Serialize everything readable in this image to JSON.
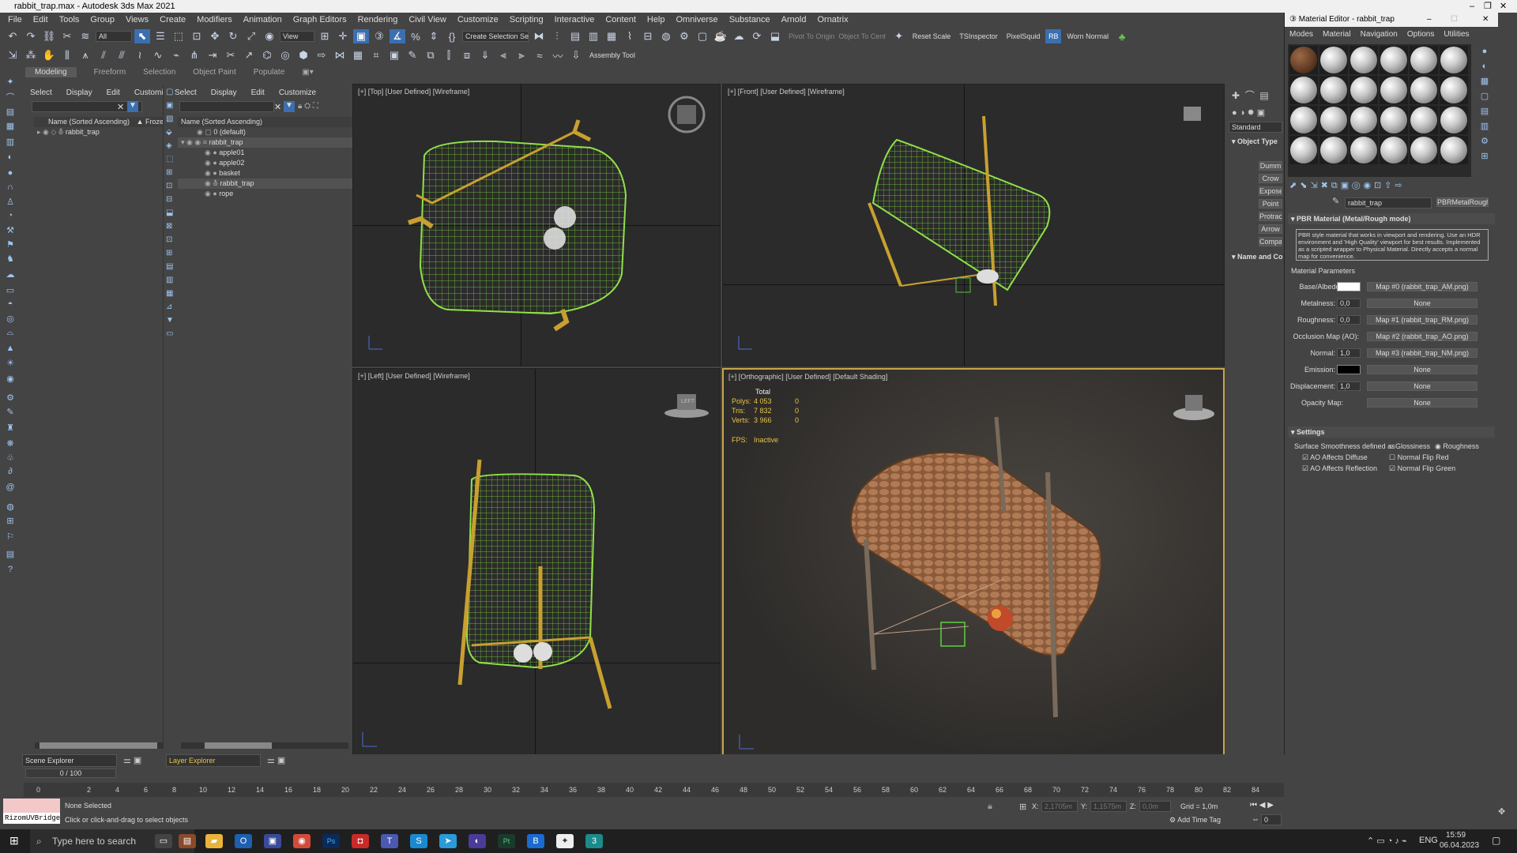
{
  "window": {
    "title": "rabbit_trap.max - Autodesk 3ds Max 2021",
    "controls": [
      "–",
      "❐",
      "✕"
    ]
  },
  "menu": [
    "File",
    "Edit",
    "Tools",
    "Group",
    "Views",
    "Create",
    "Modifiers",
    "Animation",
    "Graph Editors",
    "Rendering",
    "Civil View",
    "Customize",
    "Scripting",
    "Interactive",
    "Content",
    "Help",
    "Omniverse",
    "Substance",
    "Arnold",
    "Ornatrix"
  ],
  "toolbar": {
    "selection_filter": "All",
    "ref_coord": "View",
    "selection_set": "Create Selection Se",
    "pivot_to_origin": "Pivot To Origin",
    "object_to_center": "Object To Cent",
    "reset_scale": "Reset Scale",
    "tsinspector": "TSInspector",
    "pixelsquid": "PixelSquid",
    "worn_normal": "Worn Normal",
    "assembly_tool": "Assembly Tool"
  },
  "ribbon_tabs": [
    "Modeling",
    "Freeform",
    "Selection",
    "Object Paint",
    "Populate"
  ],
  "scene_explorer": {
    "menu": [
      "Select",
      "Display",
      "Edit",
      "Customize"
    ],
    "column": "Name (Sorted Ascending)",
    "frozen_col": "▲ Frozen",
    "items": [
      "rabbit_trap"
    ],
    "footer_label": "Scene Explorer"
  },
  "layer_explorer": {
    "menu": [
      "Select",
      "Display",
      "Edit",
      "Customize"
    ],
    "column": "Name (Sorted Ascending)",
    "items": [
      "0 (default)",
      "rabbit_trap",
      "apple01",
      "apple02",
      "basket",
      "rabbit_trap",
      "rope"
    ],
    "footer_label": "Layer Explorer"
  },
  "viewports": {
    "top": "[+] [Top] [User Defined] [Wireframe]",
    "front": "[+] [Front] [User Defined] [Wireframe]",
    "left": "[+] [Left] [User Defined] [Wireframe]",
    "persp": "[+] [Orthographic] [User Defined] [Default Shading]",
    "stats": {
      "header": "Total",
      "polys_label": "Polys:",
      "polys": "4 053",
      "polys_sel": "0",
      "tris_label": "Tris:",
      "tris": "7 832",
      "tris_sel": "0",
      "verts_label": "Verts:",
      "verts": "3 966",
      "verts_sel": "0",
      "fps_label": "FPS:",
      "fps": "Inactive"
    },
    "cube_left": "LEFT"
  },
  "command_panel": {
    "dropdown": "Standard",
    "object_type": "Object Type",
    "buttons": [
      "Dumm",
      "Crow",
      "Expose",
      "Point",
      "Protrac",
      "Arrow",
      "Compa"
    ],
    "name_and_color": "Name and Co"
  },
  "material_editor": {
    "title": "Material Editor - rabbit_trap",
    "menu": [
      "Modes",
      "Material",
      "Navigation",
      "Options",
      "Utilities"
    ],
    "material_name": "rabbit_trap",
    "material_type": "PBRMetalRough",
    "rollout_title": "PBR Material (Metal/Rough mode)",
    "description": "PBR style material that works in viewport and rendering. Use an HDR environment and 'High Quality' viewport for best results. Implemented as a scripted wrapper to Physical Material. Directly accepts a normal map for convenience.",
    "params_header": "Material Parameters",
    "params": [
      {
        "label": "Base/Albedo:",
        "value": "",
        "map": "Map #0 (rabbit_trap_AM.png)"
      },
      {
        "label": "Metalness:",
        "value": "0,0",
        "map": "None"
      },
      {
        "label": "Roughness:",
        "value": "0,0",
        "map": "Map #1 (rabbit_trap_RM.png)"
      },
      {
        "label": "Occlusion Map (AO):",
        "value": "",
        "map": "Map #2 (rabbit_trap_AO.png)"
      },
      {
        "label": "Normal:",
        "value": "1,0",
        "map": "Map #3 (rabbit_trap_NM.png)"
      },
      {
        "label": "Emission:",
        "value": "",
        "map": "None"
      },
      {
        "label": "Displacement:",
        "value": "1,0",
        "map": "None"
      },
      {
        "label": "Opacity Map:",
        "value": "",
        "map": "None"
      }
    ],
    "settings": {
      "header": "Settings",
      "smoothness_label": "Surface Smoothness defined as",
      "glossiness": "Glossiness",
      "roughness": "Roughness",
      "ao_diffuse": "AO Affects Diffuse",
      "ao_reflection": "AO Affects Reflection",
      "flip_red": "Normal Flip Red",
      "flip_green": "Normal Flip Green"
    }
  },
  "timeline": {
    "frame": "0 / 100",
    "ticks": [
      "0",
      "2",
      "4",
      "6",
      "8",
      "10",
      "12",
      "14",
      "16",
      "18",
      "20",
      "22",
      "24",
      "26",
      "28",
      "30",
      "32",
      "34",
      "36",
      "38",
      "40",
      "42",
      "44",
      "46",
      "48",
      "50",
      "52",
      "54",
      "56",
      "58",
      "60",
      "62",
      "64",
      "66",
      "68",
      "70",
      "72",
      "74",
      "76",
      "78",
      "80",
      "82",
      "84"
    ]
  },
  "status": {
    "maxscript": "RizomUVBridge",
    "none_selected": "None Selected",
    "prompt": "Click or click-and-drag to select objects",
    "x_label": "X:",
    "x_val": "2,1705m",
    "y_label": "Y:",
    "y_val": "1,1575m",
    "z_label": "Z:",
    "z_val": "0,0m",
    "grid": "Grid = 1,0m",
    "add_time_tag": "Add Time Tag",
    "frame_field": "0"
  },
  "taskbar": {
    "search": "Type here to search",
    "lang": "ENG",
    "time": "15:59",
    "date": "06.04.2023"
  }
}
